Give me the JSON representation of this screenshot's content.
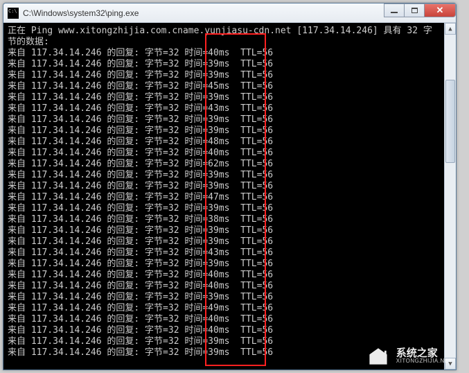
{
  "window": {
    "title": "C:\\Windows\\system32\\ping.exe"
  },
  "ping": {
    "header_prefix": "正在 Ping ",
    "hostname": "www.xitongzhijia.com.cname.yunjiasu-cdn.net",
    "ip": "117.34.14.246",
    "header_suffix1": " 具有 32 字",
    "header_line2": "节的数据:",
    "reply_prefix": "来自 ",
    "reply_mid": " 的回复: 字节=32 时间=",
    "reply_ttl": " TTL=56",
    "times_ms": [
      40,
      39,
      39,
      45,
      39,
      43,
      39,
      39,
      48,
      40,
      62,
      39,
      39,
      47,
      39,
      38,
      39,
      39,
      43,
      39,
      40,
      40,
      39,
      49,
      40,
      40,
      39,
      39
    ]
  },
  "watermark": {
    "cn": "系统之家",
    "en": "XITONGZHIJIA.NET"
  },
  "colors": {
    "console_bg": "#000000",
    "console_fg": "#cccccc",
    "highlight_box": "#ff2020",
    "close_btn": "#c8433a"
  }
}
